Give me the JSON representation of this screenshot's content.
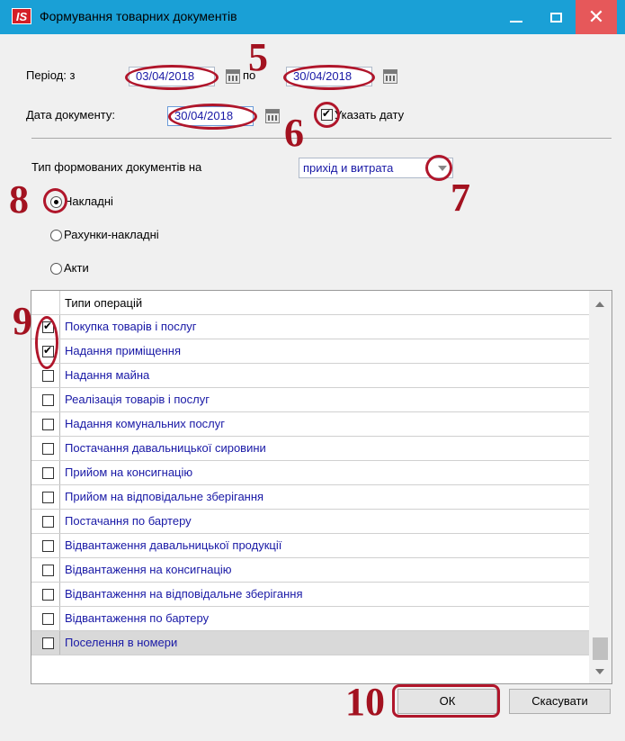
{
  "window": {
    "logo": "IS",
    "title": "Формування товарних документів",
    "minimize_icon": "minimize-icon",
    "maximize_icon": "maximize-icon",
    "close_icon": "close-icon",
    "close_glyph": "✕"
  },
  "period": {
    "label": "Період: з",
    "from": "03/04/2018",
    "to_label": "по",
    "to": "30/04/2018"
  },
  "doc_date": {
    "label": "Дата документу:",
    "value": "30/04/2018",
    "specify_label": "Указать дату",
    "specify_checked": true
  },
  "doc_type": {
    "label": "Тип формованих документів на",
    "value": "прихід и витрата"
  },
  "kind_options": [
    {
      "label": "Накладні",
      "selected": true
    },
    {
      "label": "Рахунки-накладні",
      "selected": false
    },
    {
      "label": "Акти",
      "selected": false
    }
  ],
  "operations": {
    "header": "Типи операцій",
    "rows": [
      {
        "label": "Покупка товарів і послуг",
        "checked": true
      },
      {
        "label": "Надання приміщення",
        "checked": true
      },
      {
        "label": "Надання майна",
        "checked": false
      },
      {
        "label": "Реалізація товарів і послуг",
        "checked": false
      },
      {
        "label": "Надання комунальних послуг",
        "checked": false
      },
      {
        "label": "Постачання давальницької сировини",
        "checked": false
      },
      {
        "label": "Прийом на консигнацію",
        "checked": false
      },
      {
        "label": "Прийом на відповідальне зберігання",
        "checked": false
      },
      {
        "label": "Постачання по бартеру",
        "checked": false
      },
      {
        "label": "Відвантаження давальницької продукції",
        "checked": false
      },
      {
        "label": "Відвантаження на консигнацію",
        "checked": false
      },
      {
        "label": "Відвантаження на відповідальне зберігання",
        "checked": false
      },
      {
        "label": "Відвантаження по бартеру",
        "checked": false
      },
      {
        "label": "Поселення в номери",
        "checked": false,
        "selected": true
      }
    ]
  },
  "buttons": {
    "ok": "ОК",
    "cancel": "Скасувати"
  },
  "annotations": {
    "n5": "5",
    "n6": "6",
    "n7": "7",
    "n8": "8",
    "n9": "9",
    "n10": "10",
    "color": "#b0162b"
  }
}
